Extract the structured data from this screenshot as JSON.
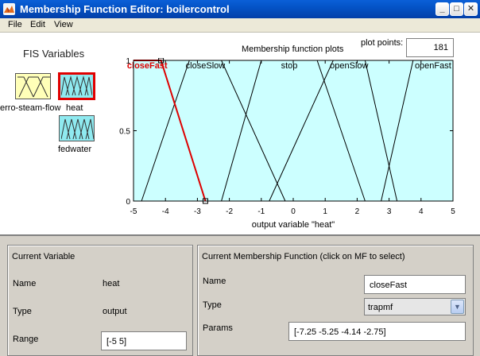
{
  "window": {
    "title": "Membership Function Editor: boilercontrol",
    "minimize_glyph": "_",
    "maximize_glyph": "□",
    "close_glyph": "✕"
  },
  "menu": {
    "items": [
      "File",
      "Edit",
      "View"
    ]
  },
  "fis_variables": {
    "title": "FIS Variables",
    "variables": [
      {
        "label": "erro-steam-flow",
        "kind": "input"
      },
      {
        "label": "heat",
        "kind": "output",
        "selected": true
      },
      {
        "label": "fedwater",
        "kind": "input"
      }
    ]
  },
  "plot": {
    "header": "Membership function plots",
    "points_label": "plot points:",
    "points_value": "181"
  },
  "chart_data": {
    "type": "line",
    "xlabel": "output variable \"heat\"",
    "xlim": [
      -5,
      5
    ],
    "ylim": [
      0,
      1
    ],
    "x_ticks": [
      -5,
      -4,
      -3,
      -2,
      -1,
      0,
      1,
      2,
      3,
      4,
      5
    ],
    "y_ticks": [
      0,
      0.5,
      1
    ],
    "background_color": "#ccffff",
    "selected_color": "#dd0000",
    "line_color": "#000000",
    "series": [
      {
        "name": "closeFast",
        "mf_type": "trapmf",
        "params": [
          -7.25,
          -5.25,
          -4.14,
          -2.75
        ],
        "selected": true
      },
      {
        "name": "closeSlow",
        "mf_type": "trapmf",
        "params": [
          -4.75,
          -3.25,
          -2.25,
          -0.25
        ]
      },
      {
        "name": "stop",
        "mf_type": "trapmf",
        "params": [
          -2.25,
          -1,
          0.75,
          2.25
        ]
      },
      {
        "name": "openSlow",
        "mf_type": "trapmf",
        "params": [
          -0.75,
          1.25,
          2.25,
          3.25
        ]
      },
      {
        "name": "openFast",
        "mf_type": "trapmf",
        "params": [
          2.75,
          3.75,
          5.25,
          7.25
        ]
      }
    ]
  },
  "current_variable": {
    "title": "Current Variable",
    "name_label": "Name",
    "name_value": "heat",
    "type_label": "Type",
    "type_value": "output",
    "range_label": "Range",
    "range_value": "[-5 5]"
  },
  "current_mf": {
    "title": "Current Membership Function (click on MF to select)",
    "name_label": "Name",
    "name_value": "closeFast",
    "type_label": "Type",
    "type_value": "trapmf",
    "params_label": "Params",
    "params_value": "[-7.25 -5.25 -4.14 -2.75]"
  }
}
